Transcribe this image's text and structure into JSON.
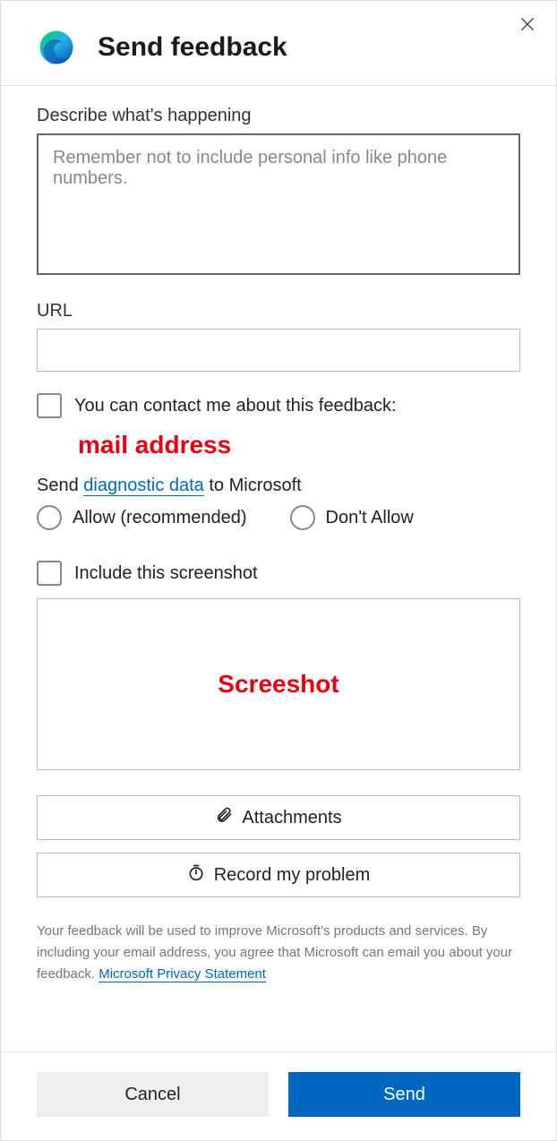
{
  "header": {
    "title": "Send feedback"
  },
  "describe": {
    "label": "Describe what's happening",
    "placeholder": "Remember not to include personal info like phone numbers."
  },
  "url": {
    "label": "URL",
    "value": ""
  },
  "contact": {
    "label": "You can contact me about this feedback:",
    "annotation": "mail address"
  },
  "diagnostic": {
    "prefix": "Send ",
    "link": "diagnostic data",
    "suffix": " to Microsoft",
    "allow": "Allow (recommended)",
    "dont_allow": "Don't Allow"
  },
  "screenshot": {
    "label": "Include this screenshot",
    "annotation": "Screeshot"
  },
  "actions": {
    "attachments": "Attachments",
    "record": "Record my problem"
  },
  "disclaimer": {
    "text": "Your feedback will be used to improve Microsoft's products and services. By including your email address, you agree that Microsoft can email you about your feedback. ",
    "link": "Microsoft Privacy Statement"
  },
  "footer": {
    "cancel": "Cancel",
    "send": "Send"
  }
}
